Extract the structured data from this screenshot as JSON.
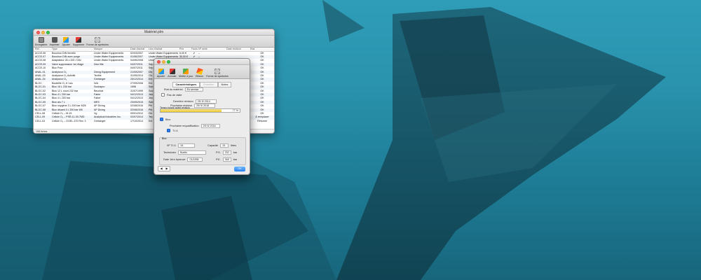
{
  "colors": {
    "ok": "#19a51b",
    "bad": "#d0161b",
    "ref": "#c0392b",
    "water": "#2a93ad"
  },
  "main_window": {
    "title": "Matériel.plm",
    "toolbar": [
      {
        "label": "Enregistrer",
        "icon": "save-icon"
      },
      {
        "label": "Imprimer",
        "icon": "print-icon"
      },
      {
        "label": "Ajouter",
        "icon": "add-icon"
      },
      {
        "label": "Supprimer",
        "icon": "delete-icon"
      },
      {
        "label": "Forme de symboles",
        "icon": "symbols-icon"
      }
    ],
    "columns": [
      "Réf.",
      "Type",
      "Marque",
      "Date d'achat",
      "Lieu d'achat",
      "Prix",
      "Factu",
      "Nº série",
      "Date révision",
      "Etat"
    ],
    "rows": [
      [
        "ACCE-06",
        "Bouchon DIN femelle",
        "Under Water Equipements",
        "02/03/2007",
        "Under Water Equipements",
        "6,00 €",
        "✔",
        "–",
        "",
        "OK"
      ],
      [
        "ACCE-07",
        "Bouchon DIN avec purge",
        "Under Water Equipements",
        "01/06/2007",
        "Under Water Equipements",
        "30,00 €",
        "✔",
        "–",
        "",
        "OK"
      ],
      [
        "ACCE-08",
        "Adaptateur 26 x 200 / DIN",
        "Under Water Equipements",
        "04/06/2008",
        "Under Water Equipements",
        "",
        "",
        "",
        "",
        "OK"
      ],
      [
        "ACCE-09",
        "Valve suppression 1er étage",
        "Dive filte",
        "04/07/2011",
        "Sep",
        "",
        "",
        "",
        "",
        "OK"
      ],
      [
        "ACCE-10",
        "Bloc Pour",
        "",
        "04/07/2011",
        "Sep",
        "",
        "",
        "",
        "",
        "OK"
      ],
      [
        "ANAL-01",
        "Analyseur O₂",
        "Diving Equipement",
        "21/05/2007",
        "Div",
        "",
        "",
        "",
        "",
        "OK"
      ],
      [
        "ANAL-03",
        "Analyseur O₂ Activité",
        "TecMe",
        "31/05/2014",
        "Clu",
        "",
        "",
        "",
        "",
        "OK"
      ],
      [
        "ANAL-04",
        "Analyseur O₂",
        "Greisinger",
        "25/12/2014",
        "Ent",
        "",
        "",
        "",
        "",
        "OK"
      ],
      [
        "BLOC",
        "Bouteille O₂ 6 l alu",
        "N/A",
        "27/09/2008",
        "Ent",
        "",
        "",
        "",
        "",
        "OK"
      ],
      [
        "BLOC-01",
        "Bloc 15 L 230 bar",
        "Scubapro",
        "1996",
        "Sub",
        "",
        "",
        "",
        "",
        "OK"
      ],
      [
        "BLOC-02",
        "Bloc 12 L court 232 bar",
        "Beuchat",
        "31/07/1999",
        "Sca",
        "",
        "",
        "",
        "",
        "OK"
      ],
      [
        "BLOC-03",
        "Bloc 4 L 200 bar",
        "Faber",
        "04/12/2013",
        "Jea",
        "",
        "",
        "",
        "",
        "OK"
      ],
      [
        "BLOC-04",
        "Bloc 4 L 200 bar",
        "Faber",
        "04/12/2013",
        "Jea",
        "",
        "",
        "",
        "",
        "OK"
      ],
      [
        "BLOC-05",
        "Bloc alu 7 L",
        "MES",
        "23/05/2015",
        "Sub",
        "",
        "",
        "",
        "",
        "OK"
      ],
      [
        "BLOC-07",
        "Bloc oxygène 3 L 200 bar M26",
        "AP Diving",
        "02/08/2016",
        "Phi",
        "",
        "",
        "",
        "",
        "OK"
      ],
      [
        "BLOC-08",
        "Bloc diluant 3 L 200 bar 5/8",
        "AP Diving",
        "02/08/2016",
        "Phi",
        "",
        "",
        "",
        "",
        "OK"
      ],
      [
        "CELL-08",
        "Cellule O₂ – M-15",
        "Vg",
        "09/01/2012",
        "Div",
        "",
        "",
        "",
        "",
        "OK"
      ],
      [
        "CELL-09",
        "Cellule O₂ – PSR-11-39-7MD",
        "Analytical Industries Inc.",
        "02/07/2014",
        "Tec",
        "",
        "",
        "",
        "",
        "À remplacer"
      ],
      [
        "CELL-04",
        "Cellule O₂ – GOEL-370 Rev. 3",
        "Greisinger",
        "17/10/2014",
        "Ent",
        "",
        "",
        "",
        "",
        "Réformé"
      ]
    ],
    "status": "108 fiches"
  },
  "detail_window": {
    "toolbar": [
      {
        "label": "Ajouter",
        "icon": "add-icon"
      },
      {
        "label": "Annuler",
        "icon": "cancel-icon"
      },
      {
        "label": "Mettre à jour",
        "icon": "update-icon"
      },
      {
        "label": "Effacer",
        "icon": "erase-icon"
      },
      {
        "label": "Forme de symboles",
        "icon": "symbols-icon"
      }
    ],
    "tabs": [
      "Caractéristiques",
      "Entretien",
      "Notes"
    ],
    "etat_label": "Etat du matériel",
    "etat_value": "En service",
    "pas_de_visite": "Pas de visite",
    "derniere_revision_label": "Dernière révision",
    "derniere_revision_value": "29/ 5/ 2014",
    "prochaine_revision_label": "Prochaine révision",
    "prochaine_revision_value": "29/ 5/ 2016",
    "temps_label": "Temps écoulé avant révision",
    "temps_value": "77 %",
    "temps_fraction": 0.77,
    "bloc_label": "Bloc",
    "requalif_label": "Prochaine requalification",
    "requalif_value": "29/ 8/ 2016",
    "tiv_label": "T.I.V.",
    "group_label": "Bloc",
    "no_tiv_label": "Nº T.I.V.",
    "no_tiv_value": "34",
    "capacite_label": "Capacité",
    "capacite_value": "15",
    "capacite_unit": "litres",
    "technicien_label": "Technicien",
    "technicien_value": "Boelts",
    "ps_label": "P.S.",
    "ps_value": "232",
    "ps_unit": "bar",
    "date_epreuve_label": "Date 1ère épreuve",
    "date_epreuve_value": "01/1996",
    "pe_label": "P.E.",
    "pe_value": "348",
    "pe_unit": "bar",
    "ok_label": "OK"
  }
}
